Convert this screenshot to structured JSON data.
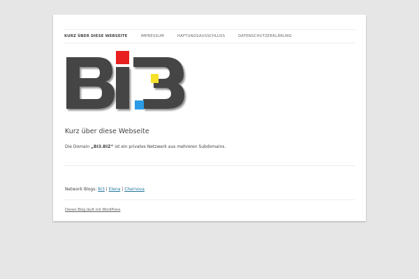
{
  "nav": {
    "items": [
      {
        "label": "KURZ ÜBER DIESE WEBSEITE",
        "current": true
      },
      {
        "label": "IMPRESSUM",
        "current": false
      },
      {
        "label": "HAFTUNGSAUSSCHLUSS",
        "current": false
      },
      {
        "label": "DATENSCHUTZERKLÄRUNG",
        "current": false
      }
    ]
  },
  "logo": {
    "text": "BI3",
    "colors": {
      "letters": "#444444",
      "red": "#e8201f",
      "yellow": "#f6e12b",
      "blue": "#2b9be8"
    }
  },
  "entry": {
    "title": "Kurz über diese Webseite",
    "text_before": "Die Domain ",
    "text_bold": "„BI3.BIZ“",
    "text_after": " ist ein privates Netzwerk aus mehreren Subdomains."
  },
  "network": {
    "label": "Network Blogs: ",
    "links": [
      "Bi3",
      "Elena",
      "Chernova"
    ],
    "separator": " | "
  },
  "footer": {
    "text": "Dieses Blog läuft mit WordPress"
  }
}
